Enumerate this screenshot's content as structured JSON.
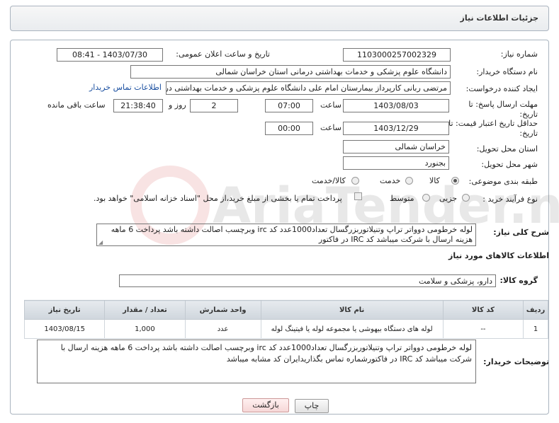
{
  "header": {
    "title": "جزئیات اطلاعات نیاز"
  },
  "fields": {
    "need_number_label": "شماره نیاز:",
    "need_number": "1103000257002329",
    "announce_label": "تاریخ و ساعت اعلان عمومی:",
    "announce_value": "1403/07/30 - 08:41",
    "buyer_org_label": "نام دستگاه خریدار:",
    "buyer_org": "دانشگاه علوم پزشکی و خدمات بهداشتی درمانی استان خراسان شمالی",
    "creator_label": "ایجاد کننده درخواست:",
    "creator": "مرتضی ربانی کارپرداز بیمارستان امام علی دانشگاه علوم پزشکی و خدمات بهداشتی درمانی استان خراسان شمالی",
    "contact_link": "اطلاعات تماس خریدار",
    "reply_deadline_label1": "مهلت ارسال پاسخ: تا",
    "reply_deadline_label2": "تاریخ:",
    "reply_date": "1403/08/03",
    "time_label": "ساعت",
    "reply_time": "07:00",
    "days_value": "2",
    "days_label": "روز و",
    "remaining_time": "21:38:40",
    "remaining_label": "ساعت باقی مانده",
    "validity_label1": "حداقل تاریخ اعتبار قیمت: تا",
    "validity_label2": "تاریخ:",
    "validity_date": "1403/12/29",
    "validity_time": "00:00",
    "province_label": "استان محل تحویل:",
    "province": "خراسان شمالی",
    "city_label": "شهر محل تحویل:",
    "city": "بجنورد",
    "category_label": "طبقه بندی موضوعی:",
    "category_options": [
      "کالا",
      "خدمت",
      "کالا/خدمت"
    ],
    "process_label": "نوع فرآیند خرید :",
    "process_options": [
      "جزیی",
      "متوسط"
    ],
    "payment_note": "پرداخت تمام یا بخشی از مبلغ خرید،از محل \"اسناد خزانه اسلامی\" خواهد بود."
  },
  "description": {
    "label": "شرح کلی نیاز:",
    "text": "لوله خرطومی  دوواتر تراپ وتنیلاتوربزرگسال تعداد1000عدد کد irc وبرچسب اصالت داشته باشد پرداخت 6 ماهه هزینه ارسال با شرکت میباشد کد IRC در فاکتور"
  },
  "goods_section": {
    "title": "اطلاعات کالاهای مورد نیاز",
    "group_label": "گروه کالا:",
    "group_value": "دارو، پزشکی و سلامت"
  },
  "table": {
    "headers": [
      "ردیف",
      "کد کالا",
      "نام کالا",
      "واحد شمارش",
      "تعداد / مقدار",
      "تاریخ نیاز"
    ],
    "rows": [
      [
        "1",
        "--",
        "لوله های دستگاه بیهوشی یا مجموعه لوله یا فیتینگ لوله",
        "عدد",
        "1,000",
        "1403/08/15"
      ]
    ]
  },
  "buyer_notes": {
    "label": "توضیحات خریدار:",
    "text": "لوله خرطومی  دوواتر تراپ وتنیلاتوربزرگسال تعداد1000عدد کد irc وبرچسب اصالت داشته باشد پرداخت 6 ماهه هزینه ارسال با شرکت میباشد کد IRC در فاکتورشماره تماس بگذاریدایران کد مشابه میباشد"
  },
  "buttons": {
    "print": "چاپ",
    "back": "بازگشت"
  },
  "watermark": "AriaTender.net"
}
